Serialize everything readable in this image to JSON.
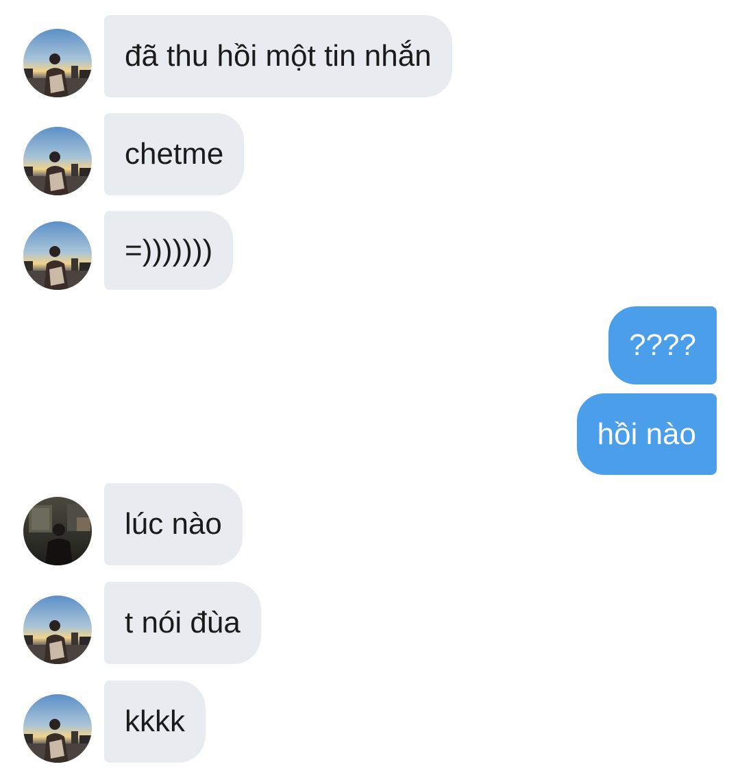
{
  "conversation": {
    "messages": [
      {
        "direction": "incoming",
        "text": "đã thu hồi một tin nhắn",
        "avatar": "sunset-city-photo"
      },
      {
        "direction": "incoming",
        "text": "chetme",
        "avatar": "sunset-city-photo"
      },
      {
        "direction": "incoming",
        "text": "=)))))))",
        "avatar": "sunset-city-photo"
      },
      {
        "direction": "outgoing",
        "text": "????"
      },
      {
        "direction": "outgoing",
        "text": "hồi nào"
      },
      {
        "direction": "incoming",
        "text": "lúc nào",
        "avatar": "dark-room-photo"
      },
      {
        "direction": "incoming",
        "text": "t nói đùa",
        "avatar": "sunset-city-photo"
      },
      {
        "direction": "incoming",
        "text": "kkkk",
        "avatar": "sunset-city-photo"
      }
    ]
  },
  "colors": {
    "incoming_bubble": "#e8ecf1",
    "outgoing_bubble": "#4a9eea",
    "incoming_text": "#1b1b1b",
    "outgoing_text": "#ffffff"
  }
}
